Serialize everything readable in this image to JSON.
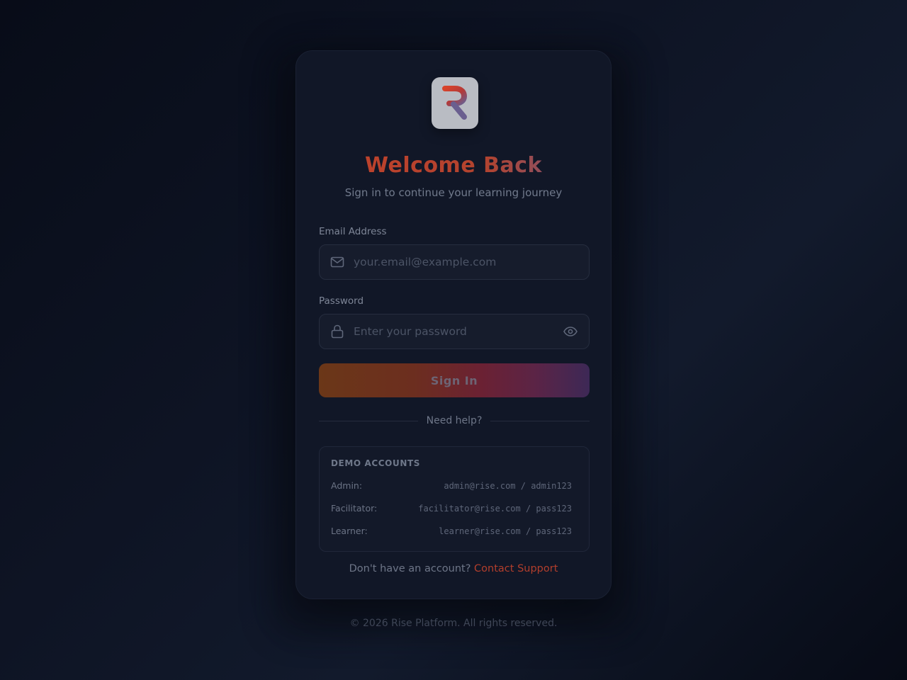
{
  "brand": {
    "logo_letter": "R",
    "colors": {
      "accent": "#c2412a",
      "accent_secondary": "#6c5a8c",
      "link": "#b23e2c"
    }
  },
  "header": {
    "title": "Welcome Back",
    "subtitle": "Sign in to continue your learning journey"
  },
  "form": {
    "email": {
      "label": "Email Address",
      "placeholder": "your.email@example.com",
      "value": "",
      "icon": "mail-icon"
    },
    "password": {
      "label": "Password",
      "placeholder": "Enter your password",
      "value": "",
      "icon": "lock-icon",
      "toggle_icon": "eye-icon"
    },
    "submit_label": "Sign In"
  },
  "help": {
    "divider_text": "Need help?"
  },
  "demo_accounts": {
    "title": "DEMO ACCOUNTS",
    "rows": [
      {
        "role": "Admin:",
        "credentials": "admin@rise.com / admin123"
      },
      {
        "role": "Facilitator:",
        "credentials": "facilitator@rise.com / pass123"
      },
      {
        "role": "Learner:",
        "credentials": "learner@rise.com / pass123"
      }
    ]
  },
  "footer": {
    "prompt": "Don't have an account?",
    "link_label": "Contact Support"
  },
  "copyright": "© 2026 Rise Platform. All rights reserved."
}
